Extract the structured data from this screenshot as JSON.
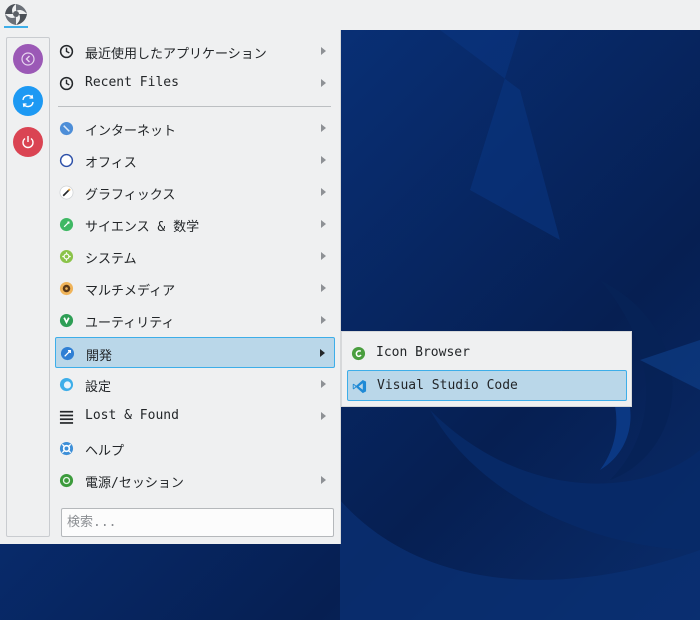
{
  "menu": {
    "items": [
      {
        "label": "最近使用したアプリケーション",
        "icon": "clock-icon",
        "has_submenu": true
      },
      {
        "label": "Recent Files",
        "icon": "clock-icon",
        "has_submenu": true
      },
      {
        "label": "インターネット",
        "icon": "internet-icon",
        "has_submenu": true
      },
      {
        "label": "オフィス",
        "icon": "office-icon",
        "has_submenu": true
      },
      {
        "label": "グラフィックス",
        "icon": "graphics-icon",
        "has_submenu": true
      },
      {
        "label": "サイエンス & 数学",
        "icon": "science-icon",
        "has_submenu": true
      },
      {
        "label": "システム",
        "icon": "system-icon",
        "has_submenu": true
      },
      {
        "label": "マルチメディア",
        "icon": "multimedia-icon",
        "has_submenu": true
      },
      {
        "label": "ユーティリティ",
        "icon": "utilities-icon",
        "has_submenu": true
      },
      {
        "label": "開発",
        "icon": "development-icon",
        "has_submenu": true,
        "active": true
      },
      {
        "label": "設定",
        "icon": "settings-icon",
        "has_submenu": true
      },
      {
        "label": "Lost & Found",
        "icon": "list-icon",
        "has_submenu": true
      },
      {
        "label": "ヘルプ",
        "icon": "help-icon",
        "has_submenu": false
      },
      {
        "label": "電源/セッション",
        "icon": "power-session-icon",
        "has_submenu": true
      }
    ],
    "search_placeholder": "検索..."
  },
  "favorites": [
    {
      "icon": "back-icon",
      "color": "#9b59b6"
    },
    {
      "icon": "sync-icon",
      "color": "#1d99f3"
    },
    {
      "icon": "power-icon",
      "color": "#da4453"
    }
  ],
  "submenu": {
    "items": [
      {
        "label": "Icon Browser",
        "icon": "icon-browser-icon"
      },
      {
        "label": "Visual Studio Code",
        "icon": "vscode-icon",
        "active": true
      }
    ]
  },
  "colors": {
    "highlight_bg": "#bad7e9",
    "highlight_border": "#3daee9",
    "panel_bg": "#eff0f1"
  }
}
